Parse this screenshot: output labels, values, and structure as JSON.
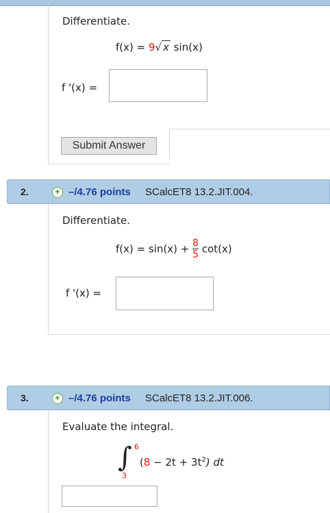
{
  "q1": {
    "prompt": "Differentiate.",
    "func_lhs": "f(x) = ",
    "func_coef": "9",
    "func_rad": "x",
    "func_rest": " sin(x)",
    "answer_label": "f '(x) = ",
    "answer_value": "",
    "submit_label": "Submit Answer"
  },
  "q2": {
    "number": "2.",
    "points": "–/4.76 points",
    "code": "SCalcET8 13.2.JIT.004.",
    "prompt": "Differentiate.",
    "func_lhs": "f(x) = sin(x) + ",
    "frac_num": "8",
    "frac_den": "5",
    "func_rest": " cot(x)",
    "answer_label": "f '(x) = ",
    "answer_value": ""
  },
  "q3": {
    "number": "3.",
    "points": "–/4.76 points",
    "code": "SCalcET8 13.2.JIT.006.",
    "prompt": "Evaluate the integral.",
    "upper": "6",
    "lower": "3",
    "open": "(",
    "integrand_a": "8",
    "integrand_b": " − 2t + 3t",
    "exp": "2",
    "integrand_c": ") dt",
    "answer_value": ""
  },
  "colors": {
    "header_bg": "#b0cde6",
    "points": "#1a3e9c",
    "highlight": "#e3170a"
  }
}
